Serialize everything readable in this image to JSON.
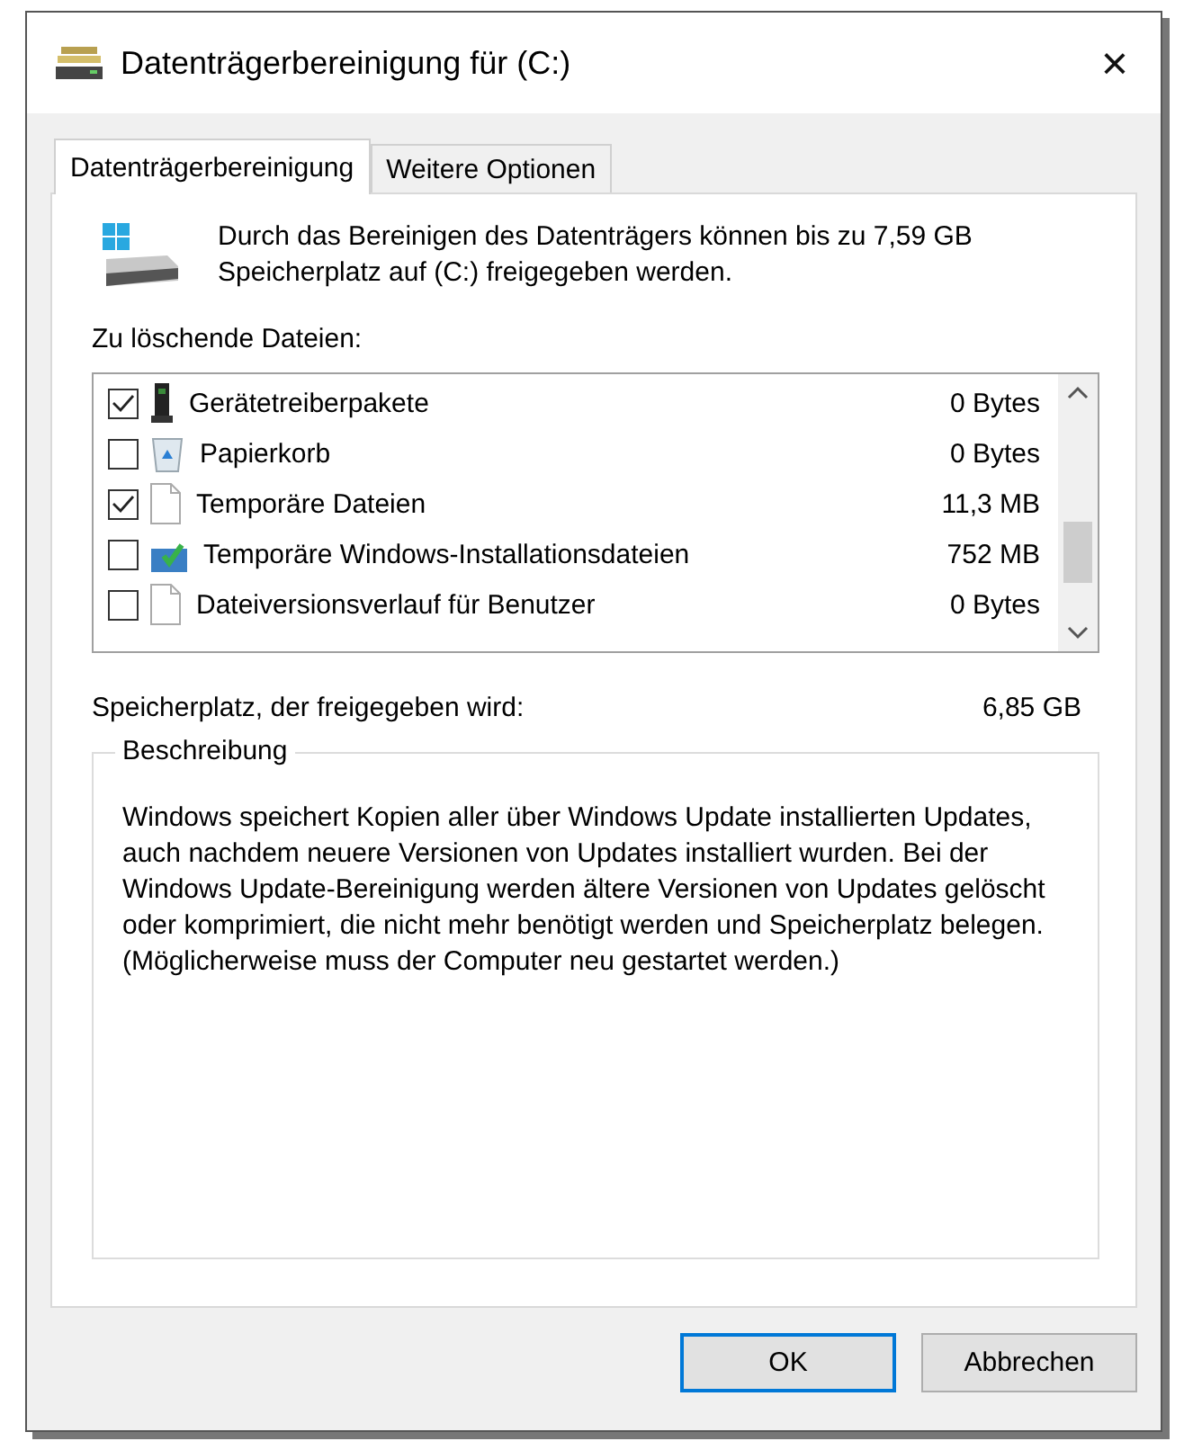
{
  "window": {
    "title": "Datenträgerbereinigung für  (C:)",
    "close": "×"
  },
  "tabs": [
    {
      "label": "Datenträgerbereinigung",
      "selected": true
    },
    {
      "label": "Weitere Optionen",
      "selected": false
    }
  ],
  "intro": "Durch das Bereinigen des Datenträgers können bis zu 7,59 GB Speicherplatz auf  (C:) freigegeben werden.",
  "files_label": "Zu löschende Dateien:",
  "files": [
    {
      "kind": "driver",
      "name": "Gerätetreiberpakete",
      "size": "0 Bytes",
      "checked": true
    },
    {
      "kind": "recycle",
      "name": "Papierkorb",
      "size": "0 Bytes",
      "checked": false
    },
    {
      "kind": "file",
      "name": "Temporäre Dateien",
      "size": "11,3 MB",
      "checked": true
    },
    {
      "kind": "setup",
      "name": "Temporäre Windows-Installationsdateien",
      "size": "752 MB",
      "checked": false
    },
    {
      "kind": "file",
      "name": "Dateiversionsverlauf für Benutzer",
      "size": "0 Bytes",
      "checked": false
    }
  ],
  "freed_label": "Speicherplatz, der freigegeben wird:",
  "freed_value": "6,85 GB",
  "description": {
    "title": "Beschreibung",
    "text": "Windows speichert Kopien aller über Windows Update installierten Updates, auch nachdem neuere Versionen von Updates installiert wurden. Bei der Windows Update-Bereinigung werden ältere Versionen von Updates gelöscht oder komprimiert, die nicht mehr benötigt werden und Speicherplatz belegen. (Möglicherweise muss der Computer neu gestartet werden.)"
  },
  "buttons": [
    {
      "label": "OK",
      "kind": "default"
    },
    {
      "label": "Abbrechen",
      "kind": "normal"
    }
  ]
}
